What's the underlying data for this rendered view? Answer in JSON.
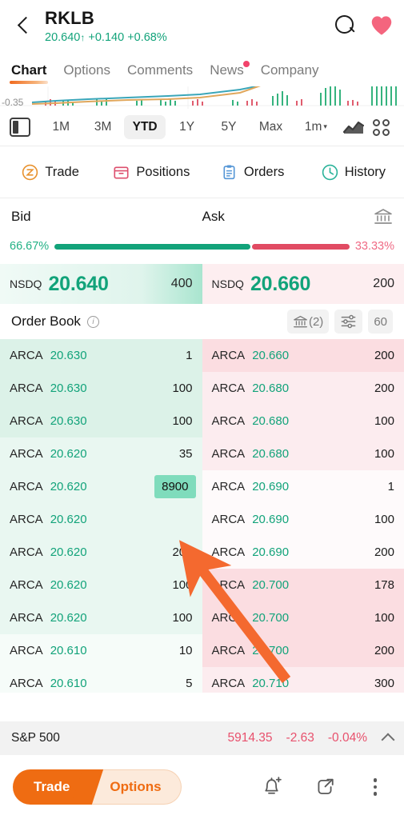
{
  "header": {
    "back_icon": "back-chevron-icon",
    "symbol": "RKLB",
    "price": "20.640",
    "arrow": "↑",
    "change": "+0.140",
    "change_pct": "+0.68%",
    "search_icon": "search-icon",
    "favorite_icon": "heart-icon",
    "accent_up": "#12a37a"
  },
  "tabs": [
    {
      "label": "Chart",
      "active": true,
      "badge": false
    },
    {
      "label": "Options",
      "active": false,
      "badge": false
    },
    {
      "label": "Comments",
      "active": false,
      "badge": false
    },
    {
      "label": "News",
      "active": false,
      "badge": true
    },
    {
      "label": "Company",
      "active": false,
      "badge": false
    }
  ],
  "chart": {
    "y_label": "-0.35",
    "line_color": "#3aa6b9",
    "ma_color": "#e0a75c",
    "up_color": "#35b37e",
    "down_color": "#e05c6e"
  },
  "range": {
    "layout_icon": "candle-layout-icon",
    "buttons": [
      {
        "label": "1M",
        "selected": false
      },
      {
        "label": "3M",
        "selected": false
      },
      {
        "label": "YTD",
        "selected": true
      },
      {
        "label": "1Y",
        "selected": false
      },
      {
        "label": "5Y",
        "selected": false
      },
      {
        "label": "Max",
        "selected": false
      }
    ],
    "interval": "1m",
    "interval_caret": "▾",
    "chart_type_icon": "line-chart-icon",
    "grid_icon": "grid-view-icon"
  },
  "actions": [
    {
      "label": "Trade",
      "icon": "trade-circle-icon",
      "color": "#e8922f"
    },
    {
      "label": "Positions",
      "icon": "positions-box-icon",
      "color": "#dd4f6e"
    },
    {
      "label": "Orders",
      "icon": "orders-clipboard-icon",
      "color": "#5596d6"
    },
    {
      "label": "History",
      "icon": "history-clock-icon",
      "color": "#2bb39a"
    }
  ],
  "bidask": {
    "bid_label": "Bid",
    "ask_label": "Ask",
    "bank_icon": "bank-icon",
    "bid_pct": "66.67%",
    "ask_pct": "33.33%",
    "bid_pct_value": 66.67,
    "ask_pct_value": 33.33,
    "bid": {
      "venue": "NSDQ",
      "price": "20.640",
      "size": "400"
    },
    "ask": {
      "venue": "NSDQ",
      "price": "20.660",
      "size": "200"
    }
  },
  "orderbook": {
    "title": "Order Book",
    "info_icon": "info-icon",
    "exchange_chip": "(2)",
    "exchange_icon": "bank-icon",
    "settings_icon": "sliders-icon",
    "depth_chip": "60",
    "bids": [
      {
        "venue": "ARCA",
        "price": "20.630",
        "size": "1",
        "shade": 3,
        "highlight": false
      },
      {
        "venue": "ARCA",
        "price": "20.630",
        "size": "100",
        "shade": 3,
        "highlight": false
      },
      {
        "venue": "ARCA",
        "price": "20.630",
        "size": "100",
        "shade": 3,
        "highlight": false
      },
      {
        "venue": "ARCA",
        "price": "20.620",
        "size": "35",
        "shade": 2,
        "highlight": false
      },
      {
        "venue": "ARCA",
        "price": "20.620",
        "size": "8900",
        "shade": 2,
        "highlight": true
      },
      {
        "venue": "ARCA",
        "price": "20.620",
        "size": "",
        "shade": 2,
        "highlight": false
      },
      {
        "venue": "ARCA",
        "price": "20.620",
        "size": "200",
        "shade": 2,
        "highlight": false
      },
      {
        "venue": "ARCA",
        "price": "20.620",
        "size": "100",
        "shade": 2,
        "highlight": false
      },
      {
        "venue": "ARCA",
        "price": "20.620",
        "size": "100",
        "shade": 2,
        "highlight": false
      },
      {
        "venue": "ARCA",
        "price": "20.610",
        "size": "10",
        "shade": 1,
        "highlight": false
      },
      {
        "venue": "ARCA",
        "price": "20.610",
        "size": "5",
        "shade": 1,
        "highlight": false
      }
    ],
    "asks": [
      {
        "venue": "ARCA",
        "price": "20.660",
        "size": "200",
        "shade": 3
      },
      {
        "venue": "ARCA",
        "price": "20.680",
        "size": "200",
        "shade": 2
      },
      {
        "venue": "ARCA",
        "price": "20.680",
        "size": "100",
        "shade": 2
      },
      {
        "venue": "ARCA",
        "price": "20.680",
        "size": "100",
        "shade": 2
      },
      {
        "venue": "ARCA",
        "price": "20.690",
        "size": "1",
        "shade": 1
      },
      {
        "venue": "ARCA",
        "price": "20.690",
        "size": "100",
        "shade": 1
      },
      {
        "venue": "ARCA",
        "price": "20.690",
        "size": "200",
        "shade": 1
      },
      {
        "venue": "ARCA",
        "price": "20.700",
        "size": "178",
        "shade": 3
      },
      {
        "venue": "ARCA",
        "price": "20.700",
        "size": "100",
        "shade": 3
      },
      {
        "venue": "ARCA",
        "price": "20.700",
        "size": "200",
        "shade": 3
      },
      {
        "venue": "ARCA",
        "price": "20.710",
        "size": "300",
        "shade": 2
      }
    ]
  },
  "annotation": {
    "type": "arrow",
    "color": "#f4692f",
    "points_to": "bid-size-8900"
  },
  "index_bar": {
    "name": "S&P 500",
    "value": "5914.35",
    "change": "-2.63",
    "change_pct": "-0.04%",
    "color": "#e8516d",
    "expand_icon": "chevron-up-icon"
  },
  "footer": {
    "trade_label": "Trade",
    "options_label": "Options",
    "alert_icon": "bell-add-icon",
    "share_icon": "share-icon",
    "more_icon": "more-vertical-icon",
    "accent": "#ef6c12"
  }
}
